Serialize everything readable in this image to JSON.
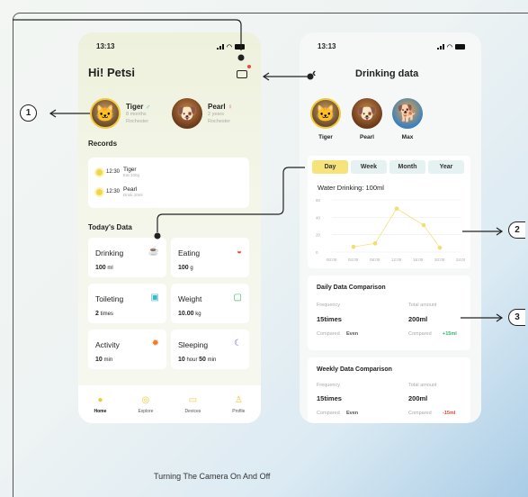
{
  "status_time": "13:13",
  "screen1": {
    "greeting": "Hi! Petsi",
    "pets": [
      {
        "name": "Tiger",
        "gender_symbol": "♂",
        "age": "8 months",
        "location": "Rochester"
      },
      {
        "name": "Pearl",
        "gender_symbol": "♀",
        "age": "2 years",
        "location": "Rochester"
      }
    ],
    "records_title": "Records",
    "records": [
      {
        "time": "12:30",
        "name": "Tiger",
        "detail": "Eat 100g"
      },
      {
        "time": "12:30",
        "name": "Pearl",
        "detail": "Drink 10ml"
      }
    ],
    "today_title": "Today's Data",
    "cards": [
      {
        "label": "Drinking",
        "value": "100",
        "unit": "ml",
        "icon": "cup-icon",
        "icon_color": "#3d8be0"
      },
      {
        "label": "Eating",
        "value": "100",
        "unit": "g",
        "icon": "bowl-icon",
        "icon_color": "#e84a3c"
      },
      {
        "label": "Toileting",
        "value": "2",
        "unit": "times",
        "icon": "toilet-icon",
        "icon_color": "#3db8c8"
      },
      {
        "label": "Weight",
        "value": "10.00",
        "unit": "kg",
        "icon": "scale-icon",
        "icon_color": "#2fb56a"
      },
      {
        "label": "Activity",
        "value": "10",
        "unit": "min",
        "icon": "gear-icon",
        "icon_color": "#f07a2a"
      },
      {
        "label": "Sleeping",
        "value": "10",
        "unit": "hour",
        "value2": "50",
        "unit2": "min",
        "icon": "moon-icon",
        "icon_color": "#7a5ce0"
      }
    ],
    "nav": [
      {
        "label": "Home",
        "icon": "home-icon"
      },
      {
        "label": "Explore",
        "icon": "compass-icon"
      },
      {
        "label": "Devices",
        "icon": "device-icon"
      },
      {
        "label": "Profile",
        "icon": "profile-icon"
      }
    ]
  },
  "screen2": {
    "title": "Drinking data",
    "pets": [
      "Tiger",
      "Pearl",
      "Max"
    ],
    "tabs": [
      "Day",
      "Week",
      "Month",
      "Year"
    ],
    "active_tab": "Day",
    "chart_caption": "Water Drinking: 100ml",
    "daily": {
      "title": "Daily Data Comparison",
      "frequency_label": "Frequency",
      "frequency_value": "15times",
      "total_label": "Total amount",
      "total_value": "200ml",
      "compared_label": "Compared",
      "compared_freq": "Even",
      "compared_total": "+15ml",
      "compared_total_color": "#2fb56a"
    },
    "weekly": {
      "title": "Weekly Data Comparison",
      "frequency_label": "Frequency",
      "frequency_value": "15times",
      "total_label": "Total amount",
      "total_value": "200ml",
      "compared_label": "Compared",
      "compared_freq": "Even",
      "compared_total": "-15ml",
      "compared_total_color": "#e84a3c"
    }
  },
  "chart_data": {
    "type": "line",
    "x": [
      "00:00",
      "04:00",
      "08:00",
      "12:00",
      "16:00",
      "20:00",
      "24:00"
    ],
    "y_ticks": [
      0,
      20,
      40,
      60
    ],
    "ylim": [
      0,
      60
    ],
    "points": [
      [
        4,
        6
      ],
      [
        8,
        10
      ],
      [
        12,
        50
      ],
      [
        17,
        31
      ],
      [
        20,
        5
      ]
    ],
    "color": "#f5de6e"
  },
  "annotations": [
    "1",
    "2",
    "3"
  ],
  "caption": "Turning The Camera On And Off"
}
